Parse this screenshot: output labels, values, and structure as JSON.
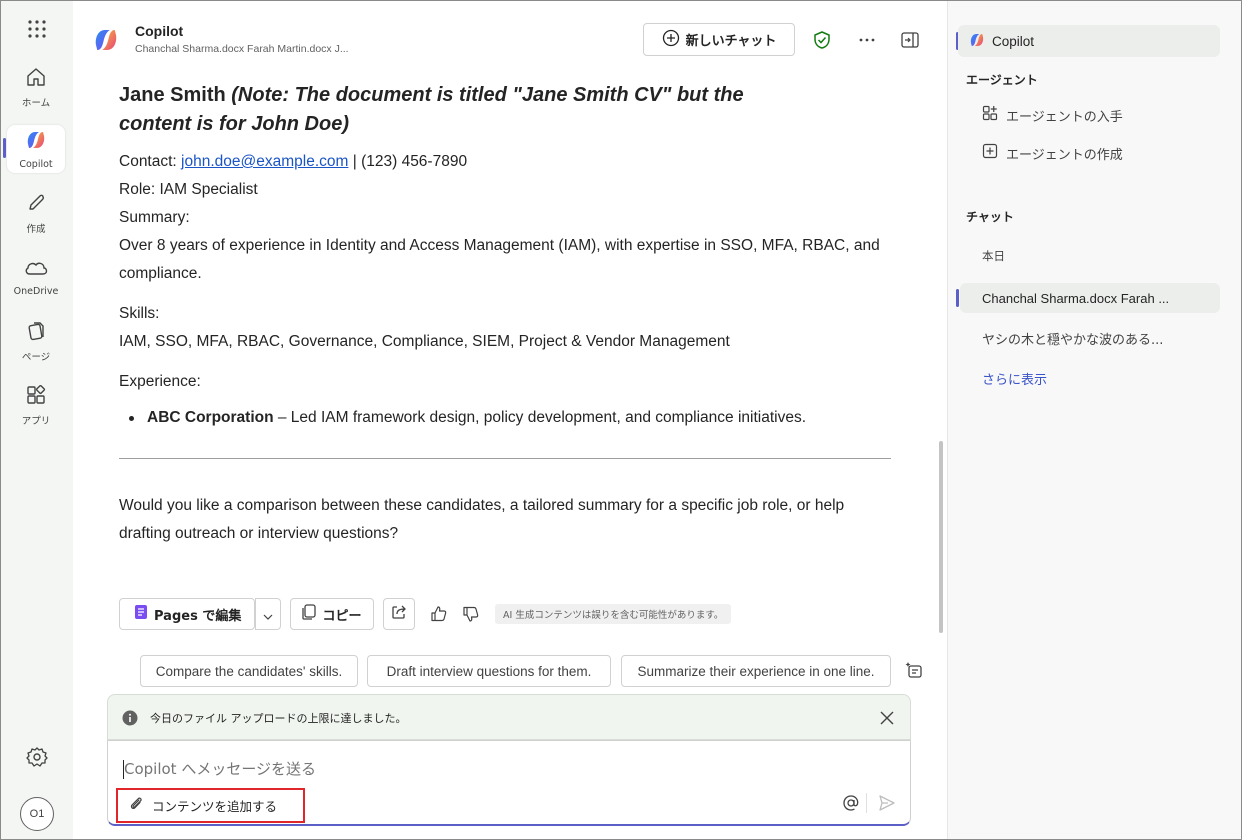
{
  "rail": {
    "items": [
      {
        "label": "ホーム"
      },
      {
        "label": "Copilot"
      },
      {
        "label": "作成"
      },
      {
        "label": "OneDrive"
      },
      {
        "label": "ページ"
      },
      {
        "label": "アプリ"
      }
    ],
    "avatar": "O1"
  },
  "header": {
    "title": "Copilot",
    "subtitle": "Chanchal Sharma.docx Farah Martin.docx J...",
    "new_chat": "新しいチャット"
  },
  "cv": {
    "name": "Jane Smith",
    "note": "(Note: The document is titled \"Jane Smith CV\" but the content is for John Doe)",
    "contact_label": "Contact:",
    "email": "john.doe@example.com",
    "phone": " | (123) 456-7890",
    "role_label": "Role:",
    "role": " IAM Specialist",
    "summary_label": "Summary:",
    "summary_1": "Over 8 years of experience in Identity and Access Management (IAM), with expertise in SSO, MFA, RBAC, and",
    "summary_2": "compliance.",
    "skills_label": "Skills:",
    "skills": "IAM, SSO, MFA, RBAC, Governance, Compliance, SIEM, Project & Vendor Management",
    "experience_label": "Experience:",
    "exp_company": "ABC Corporation",
    "exp_desc": " – Led IAM framework design, policy development, and compliance initiatives.",
    "followup_1": "Would you like a comparison between these candidates, a tailored summary for a specific job role, or help",
    "followup_2": "drafting outreach or interview questions?"
  },
  "actions": {
    "edit_pages": "Pages で編集",
    "copy": "コピー",
    "ai_note": "AI 生成コンテンツは誤りを含む可能性があります。"
  },
  "suggestions": [
    "Compare the candidates' skills.",
    "Draft interview questions for them.",
    "Summarize their experience in one line."
  ],
  "notice": {
    "text": "今日のファイル アップロードの上限に達しました。"
  },
  "composer": {
    "placeholder": "Copilot へメッセージを送る",
    "add_content": "コンテンツを追加する"
  },
  "side": {
    "copilot": "Copilot",
    "agents_heading": "エージェント",
    "get_agents": "エージェントの入手",
    "create_agent": "エージェントの作成",
    "chat_heading": "チャット",
    "today": "本日",
    "chats": [
      "Chanchal Sharma.docx Farah ...",
      "ヤシの木と穏やかな波のある..."
    ],
    "show_more": "さらに表示"
  },
  "colors": {
    "accent": "#5b5fc7",
    "link": "#1a55c6",
    "highlight_border": "#e0252b",
    "notice_bg": "#f0f6ef"
  }
}
